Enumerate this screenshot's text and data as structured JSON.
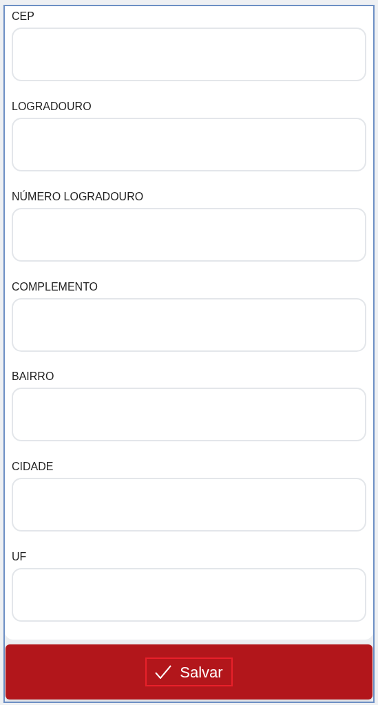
{
  "fields": [
    {
      "label": "CEP"
    },
    {
      "label": "LOGRADOURO"
    },
    {
      "label": "NÚMERO LOGRADOURO"
    },
    {
      "label": "COMPLEMENTO"
    },
    {
      "label": "BAIRRO"
    },
    {
      "label": "CIDADE"
    },
    {
      "label": "UF"
    }
  ],
  "save_button": {
    "label": "Salvar"
  }
}
